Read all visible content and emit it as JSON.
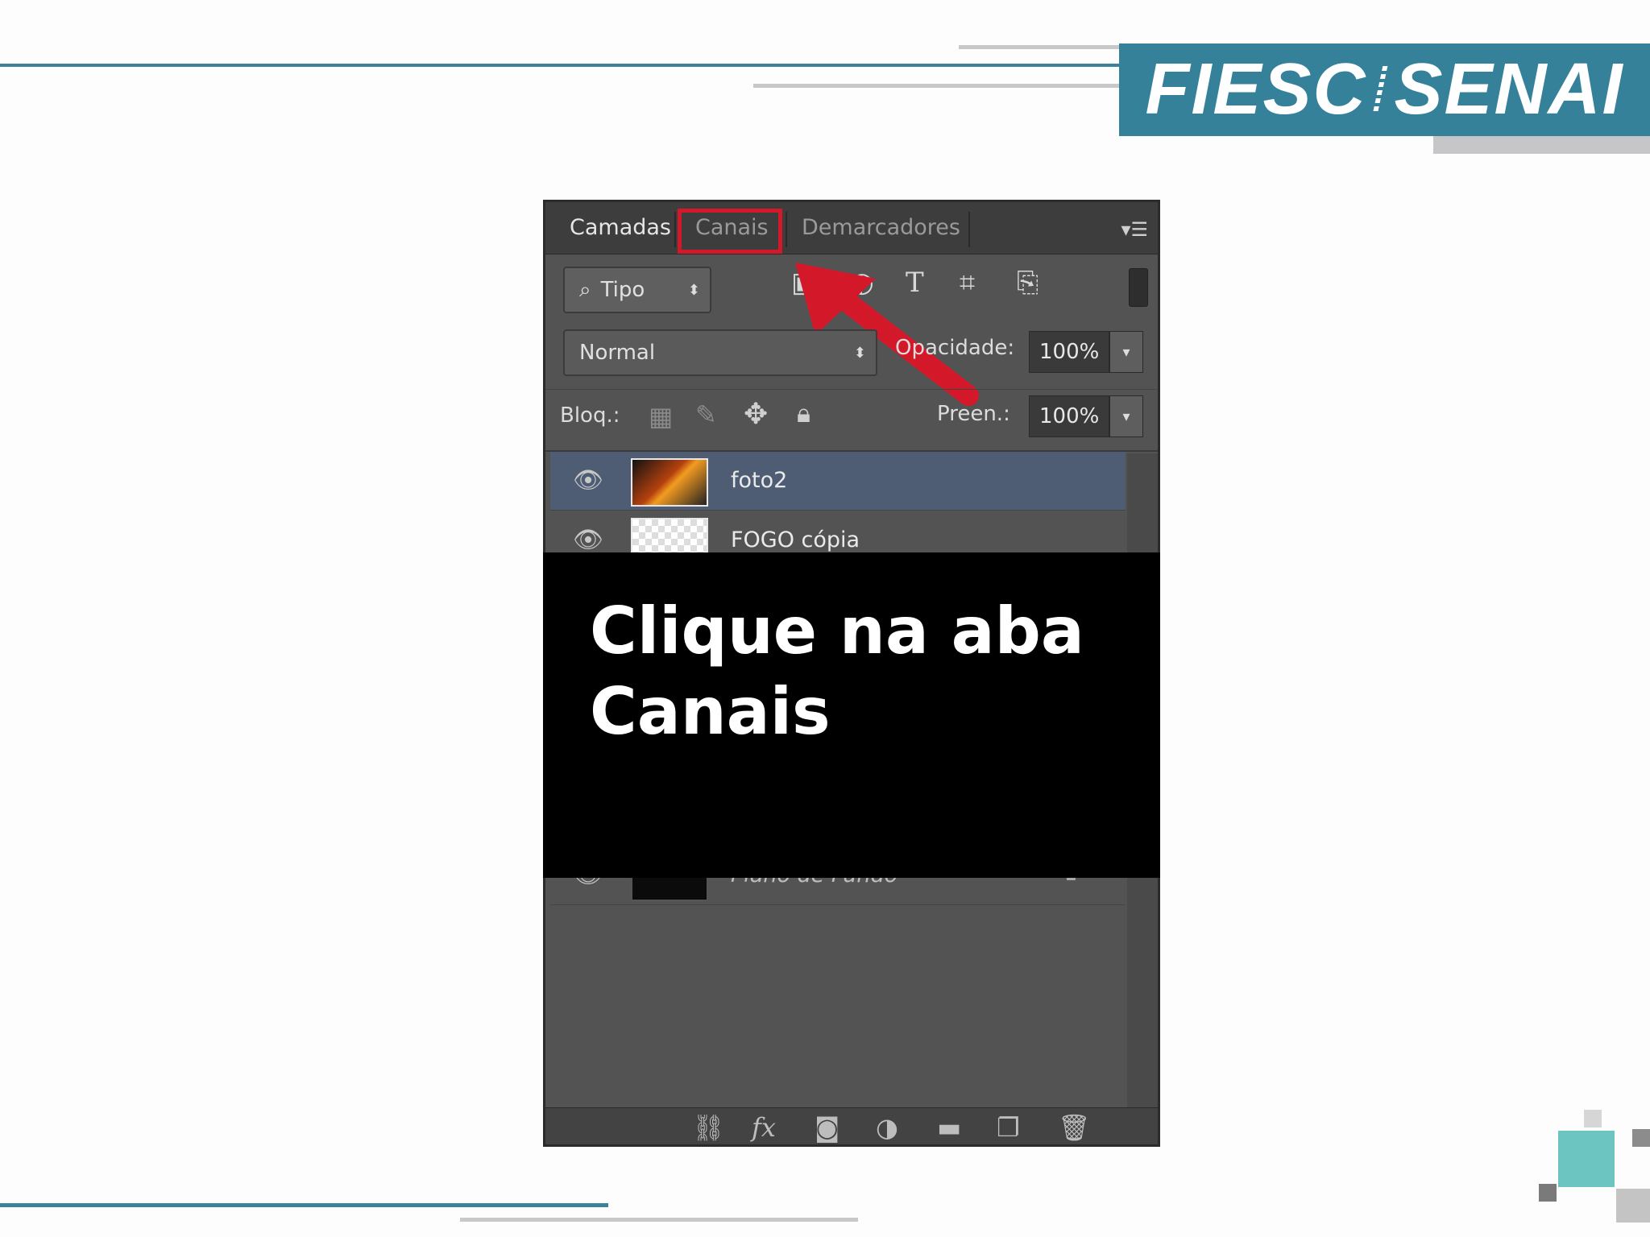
{
  "brand": {
    "logo_left": "FIESC",
    "logo_right": "SENAI",
    "teal": "#36819a",
    "accent_red": "#d3182a"
  },
  "panel": {
    "tabs": [
      {
        "label": "Camadas",
        "active": true
      },
      {
        "label": "Canais",
        "active": false,
        "highlighted": true
      },
      {
        "label": "Demarcadores",
        "active": false
      }
    ],
    "menu_icon": "panel-menu-icon",
    "filter": {
      "kind_label": "Tipo",
      "icons": [
        "image-filter-icon",
        "adjustment-filter-icon",
        "type-filter-icon",
        "shape-filter-icon",
        "smart-object-filter-icon"
      ]
    },
    "blend_mode": "Normal",
    "opacity_label": "Opacidade:",
    "opacity_value": "100%",
    "lock_label": "Bloq.:",
    "fill_label": "Preen.:",
    "fill_value": "100%",
    "layers": [
      {
        "name": "foto2",
        "selected": true
      },
      {
        "name": "FOGO cópia",
        "selected": false
      },
      {
        "name": "Plano de Fundo",
        "selected": false
      }
    ],
    "bottom_icons": [
      "link-icon",
      "fx-icon",
      "mask-icon",
      "adjustment-icon",
      "folder-icon",
      "new-layer-icon",
      "trash-icon"
    ]
  },
  "instruction": {
    "line1": "Clique na aba",
    "line2": "Canais"
  }
}
